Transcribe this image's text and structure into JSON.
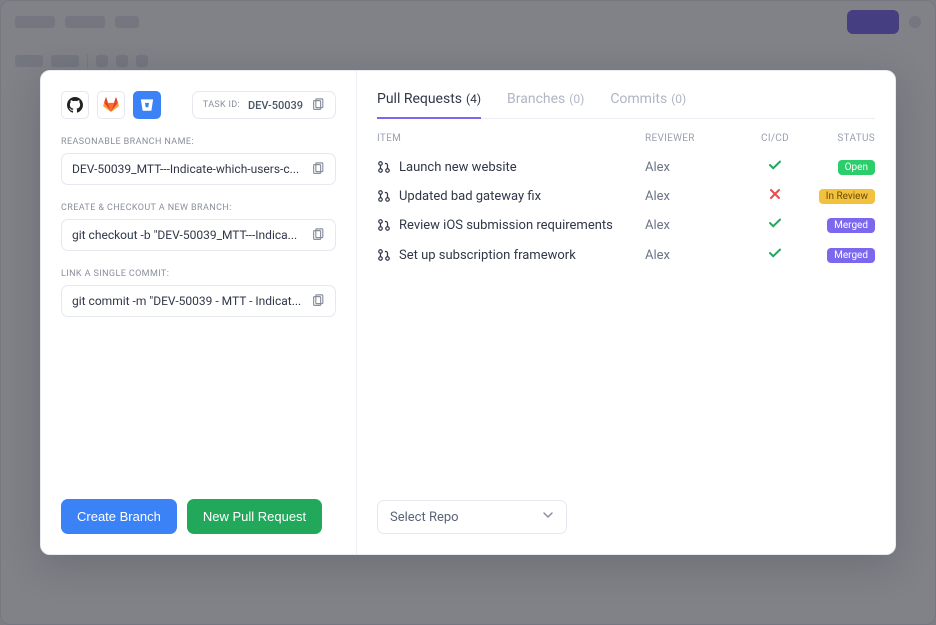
{
  "task": {
    "label": "TASK ID:",
    "id": "DEV-50039"
  },
  "sections": {
    "branch_name_label": "REASONABLE BRANCH NAME:",
    "branch_name_value": "DEV-50039_MTT---Indicate-which-users-c...",
    "checkout_label": "CREATE & CHECKOUT A NEW BRANCH:",
    "checkout_value": "git checkout -b \"DEV-50039_MTT---Indica...",
    "commit_label": "LINK A SINGLE COMMIT:",
    "commit_value": "git commit -m \"DEV-50039 - MTT - Indicat..."
  },
  "buttons": {
    "create_branch": "Create Branch",
    "new_pr": "New Pull Request"
  },
  "tabs": {
    "pr_label": "Pull Requests",
    "pr_count": "(4)",
    "branches_label": "Branches",
    "branches_count": "(0)",
    "commits_label": "Commits",
    "commits_count": "(0)"
  },
  "columns": {
    "item": "ITEM",
    "reviewer": "REVIEWER",
    "cicd": "CI/CD",
    "status": "STATUS"
  },
  "rows": [
    {
      "title": "Launch new website",
      "reviewer": "Alex",
      "ci": "ok",
      "status": "Open",
      "badge": "open"
    },
    {
      "title": "Updated bad gateway fix",
      "reviewer": "Alex",
      "ci": "bad",
      "status": "In Review",
      "badge": "review"
    },
    {
      "title": "Review iOS submission requirements",
      "reviewer": "Alex",
      "ci": "ok",
      "status": "Merged",
      "badge": "merged"
    },
    {
      "title": "Set up subscription framework",
      "reviewer": "Alex",
      "ci": "ok",
      "status": "Merged",
      "badge": "merged"
    }
  ],
  "repo_select": "Select Repo"
}
